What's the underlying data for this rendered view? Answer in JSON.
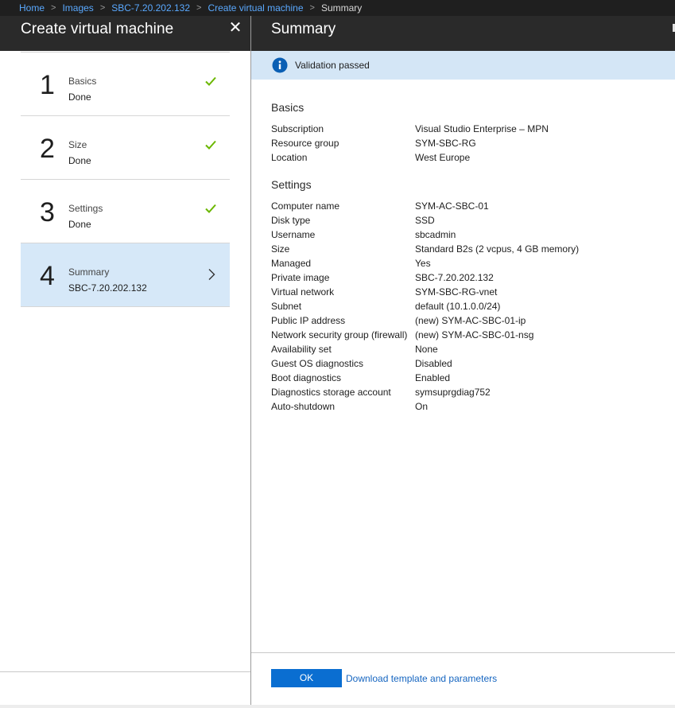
{
  "breadcrumb": {
    "items": [
      "Home",
      "Images",
      "SBC-7.20.202.132",
      "Create virtual machine"
    ],
    "current": "Summary"
  },
  "left_blade": {
    "title": "Create virtual machine",
    "close_icon": "close-icon",
    "steps": [
      {
        "number": "1",
        "name": "Basics",
        "status": "Done",
        "icon": "check-icon"
      },
      {
        "number": "2",
        "name": "Size",
        "status": "Done",
        "icon": "check-icon"
      },
      {
        "number": "3",
        "name": "Settings",
        "status": "Done",
        "icon": "check-icon"
      },
      {
        "number": "4",
        "name": "Summary",
        "status": "SBC-7.20.202.132",
        "icon": "chevron-right-icon"
      }
    ]
  },
  "right_blade": {
    "title": "Summary",
    "validation": {
      "message": "Validation passed",
      "icon": "info-icon"
    },
    "basics": {
      "title": "Basics",
      "rows": [
        {
          "label": "Subscription",
          "value": "Visual Studio Enterprise – MPN"
        },
        {
          "label": "Resource group",
          "value": "SYM-SBC-RG"
        },
        {
          "label": "Location",
          "value": "West Europe"
        }
      ]
    },
    "settings": {
      "title": "Settings",
      "rows": [
        {
          "label": "Computer name",
          "value": "SYM-AC-SBC-01"
        },
        {
          "label": "Disk type",
          "value": "SSD"
        },
        {
          "label": "Username",
          "value": "sbcadmin"
        },
        {
          "label": "Size",
          "value": "Standard B2s (2 vcpus, 4 GB memory)"
        },
        {
          "label": "Managed",
          "value": "Yes"
        },
        {
          "label": "Private image",
          "value": "SBC-7.20.202.132"
        },
        {
          "label": "Virtual network",
          "value": "SYM-SBC-RG-vnet"
        },
        {
          "label": "Subnet",
          "value": "default (10.1.0.0/24)"
        },
        {
          "label": "Public IP address",
          "value": "(new) SYM-AC-SBC-01-ip"
        },
        {
          "label": "Network security group (firewall)",
          "value": "(new) SYM-AC-SBC-01-nsg"
        },
        {
          "label": "Availability set",
          "value": "None"
        },
        {
          "label": "Guest OS diagnostics",
          "value": "Disabled"
        },
        {
          "label": "Boot diagnostics",
          "value": "Enabled"
        },
        {
          "label": "Diagnostics storage account",
          "value": "symsuprgdiag752"
        },
        {
          "label": "Auto-shutdown",
          "value": "On"
        }
      ]
    },
    "ok_label": "OK",
    "download_link": "Download template and parameters"
  },
  "colors": {
    "accent": "#0a6ed1",
    "link": "#5aa9ff",
    "check": "#6bb700",
    "validation_bg": "#d4e6f6",
    "header_bg": "#2a2a2a"
  }
}
